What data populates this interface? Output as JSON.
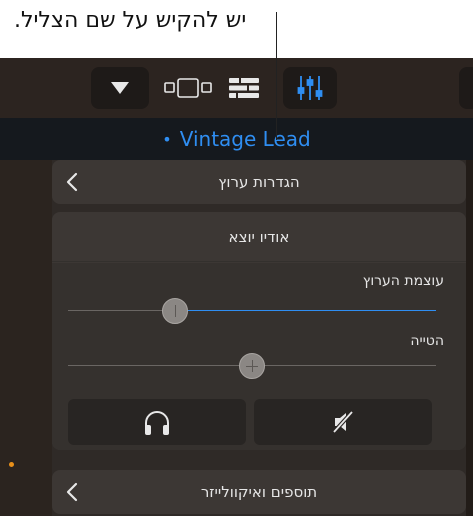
{
  "callout": {
    "text": "יש להקיש על שם הצליל."
  },
  "toolbar": {
    "buttons": [
      {
        "name": "dropdown-button",
        "icon": "triangle-down-icon"
      },
      {
        "name": "keyboard-view-button",
        "icon": "keyboard-layout-icon"
      },
      {
        "name": "tracks-view-button",
        "icon": "tracks-list-icon"
      },
      {
        "name": "controls-button",
        "icon": "sliders-icon",
        "active_color": "#2f8ef2"
      }
    ]
  },
  "patch": {
    "dot": "•",
    "name": "Vintage Lead"
  },
  "panel": {
    "track_settings": {
      "label": "הגדרות ערוץ"
    },
    "audio_output": {
      "title": "אודיו יוצא",
      "volume": {
        "label": "עוצמת הערוץ",
        "value": 0.29
      },
      "pan": {
        "label": "הטייה",
        "value": 0.5
      },
      "mute_icon": "speaker-muted-icon",
      "solo_icon": "headphones-icon"
    },
    "plugins_eq": {
      "label": "תוספים ואיקוולייזר"
    }
  },
  "colors": {
    "accent": "#2f8ef2",
    "background": "#2a221d"
  }
}
